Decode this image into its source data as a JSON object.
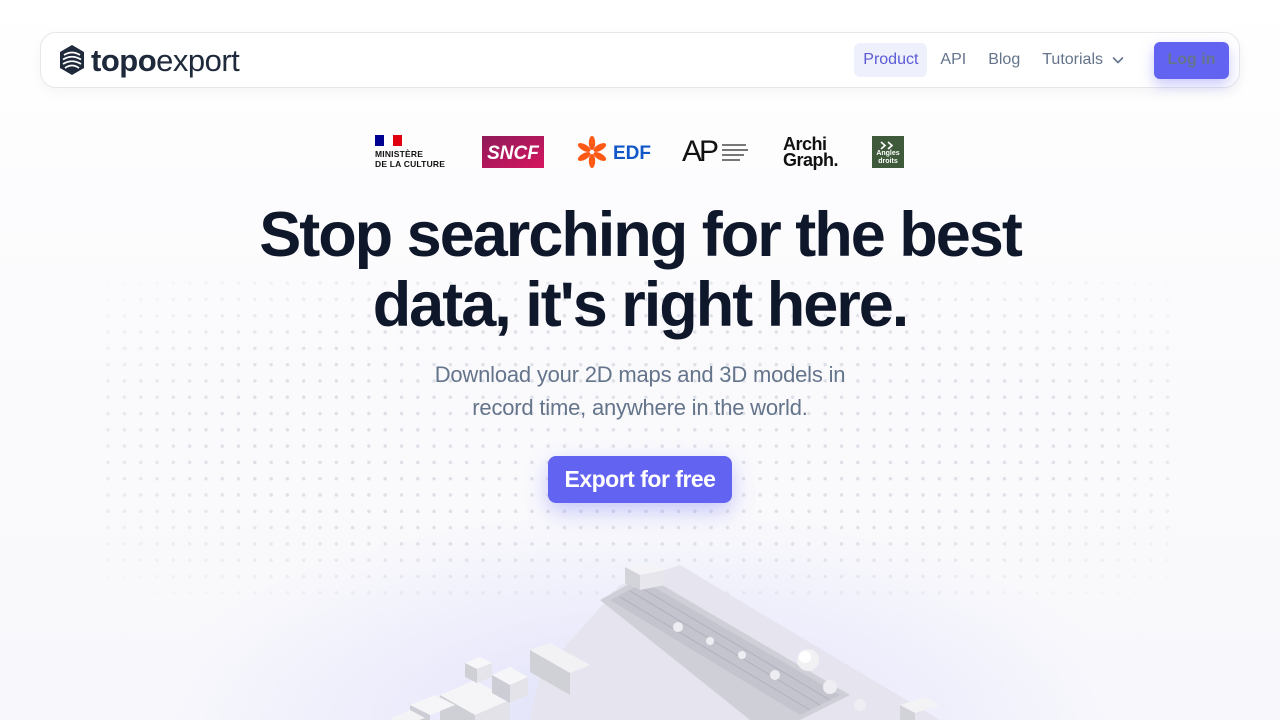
{
  "brand": {
    "bold": "topo",
    "light": "export"
  },
  "nav": {
    "items": [
      {
        "label": "Product",
        "active": true
      },
      {
        "label": "API",
        "active": false
      },
      {
        "label": "Blog",
        "active": false
      },
      {
        "label": "Tutorials",
        "active": false,
        "dropdown": true
      }
    ],
    "login": "Log in"
  },
  "partners": [
    {
      "name": "Ministère de la Culture",
      "line1": "MINISTÈRE",
      "line2": "DE LA CULTURE"
    },
    {
      "name": "SNCF",
      "text": "SNCF"
    },
    {
      "name": "EDF",
      "text": "EDF"
    },
    {
      "name": "AP",
      "text": "AP"
    },
    {
      "name": "Archi Graph.",
      "line1": "Archi",
      "line2": "Graph."
    },
    {
      "name": "Angles droits",
      "line1": "Angles",
      "line2": "droits"
    }
  ],
  "hero": {
    "title_line1": "Stop searching for the best",
    "title_line2": "data, it's right here.",
    "subtitle_line1": "Download your 2D maps and 3D models in",
    "subtitle_line2": "record time, anywhere in the world.",
    "cta": "Export for free"
  },
  "colors": {
    "accent": "#6363f1",
    "heading": "#0f172a",
    "muted": "#64748b",
    "active_bg": "#eef0fb",
    "edf_orange": "#fe5815",
    "edf_blue": "#1057c8",
    "sncf_magenta": "#b3186d",
    "angles_green": "#3e5a3a"
  },
  "icons": {
    "logo_mark": "topoexport-logo-icon",
    "dropdown": "chevron-down-icon"
  }
}
